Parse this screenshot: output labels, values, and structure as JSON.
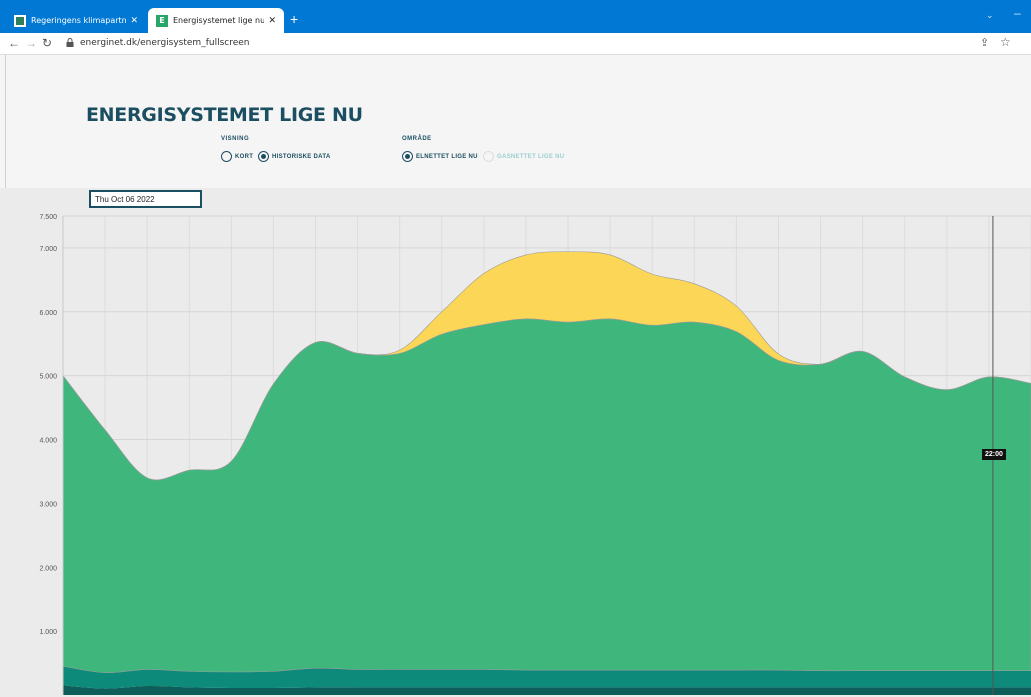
{
  "browser": {
    "tabs": [
      {
        "title": "Regeringens klimapartnerskaber",
        "active": false
      },
      {
        "title": "Energisystemet lige nu | Energin",
        "active": true
      }
    ],
    "url": "energinet.dk/energisystem_fullscreen"
  },
  "page": {
    "title": "ENERGISYSTEMET LIGE NU",
    "visning": {
      "label": "VISNING",
      "options": [
        {
          "label": "KORT",
          "selected": false
        },
        {
          "label": "HISTORISKE DATA",
          "selected": true
        }
      ]
    },
    "omraade": {
      "label": "OMRÅDE",
      "options": [
        {
          "label": "ELNETTET LIGE NU",
          "selected": true
        },
        {
          "label": "GASNETTET LIGE NU",
          "selected": false
        }
      ]
    },
    "date": "Thu Oct 06 2022",
    "tooltip": "22:00"
  },
  "colors": {
    "brand": "#1b4e60",
    "green": "#3fb77c",
    "yellow": "#fcd757",
    "teal": "#0e8a7a",
    "dark_teal": "#0d5e58",
    "browser_blue": "#0078d4"
  },
  "chart_data": {
    "type": "area",
    "ylim": [
      0,
      7500
    ],
    "y_ticks": [
      "1.000",
      "2.000",
      "3.000",
      "4.000",
      "5.000",
      "6.000",
      "7.000",
      "7.500"
    ],
    "x": [
      0,
      1,
      2,
      3,
      4,
      5,
      6,
      7,
      8,
      9,
      10,
      11,
      12,
      13,
      14,
      15,
      16,
      17,
      18,
      19,
      20,
      21,
      22,
      23
    ],
    "series": [
      {
        "color": "#0d5e58",
        "values": [
          150,
          100,
          140,
          120,
          110,
          110,
          120,
          120,
          120,
          120,
          120,
          120,
          120,
          120,
          120,
          120,
          120,
          120,
          120,
          120,
          120,
          120,
          120,
          120
        ]
      },
      {
        "color": "#0e8a7a",
        "values": [
          300,
          250,
          260,
          250,
          250,
          260,
          300,
          280,
          280,
          280,
          280,
          270,
          270,
          270,
          270,
          270,
          270,
          270,
          260,
          260,
          260,
          260,
          260,
          260
        ]
      },
      {
        "color": "#3fb77c",
        "values": [
          4550,
          3800,
          3000,
          3150,
          3300,
          4500,
          5100,
          4950,
          4950,
          5250,
          5400,
          5500,
          5450,
          5500,
          5400,
          5450,
          5300,
          4850,
          4800,
          5000,
          4600,
          4400,
          4600,
          4500
        ]
      },
      {
        "color": "#fcd757",
        "values": [
          0,
          0,
          0,
          0,
          0,
          0,
          0,
          0,
          50,
          350,
          800,
          1000,
          1100,
          1000,
          800,
          600,
          400,
          100,
          0,
          0,
          0,
          0,
          0,
          0
        ]
      }
    ]
  }
}
